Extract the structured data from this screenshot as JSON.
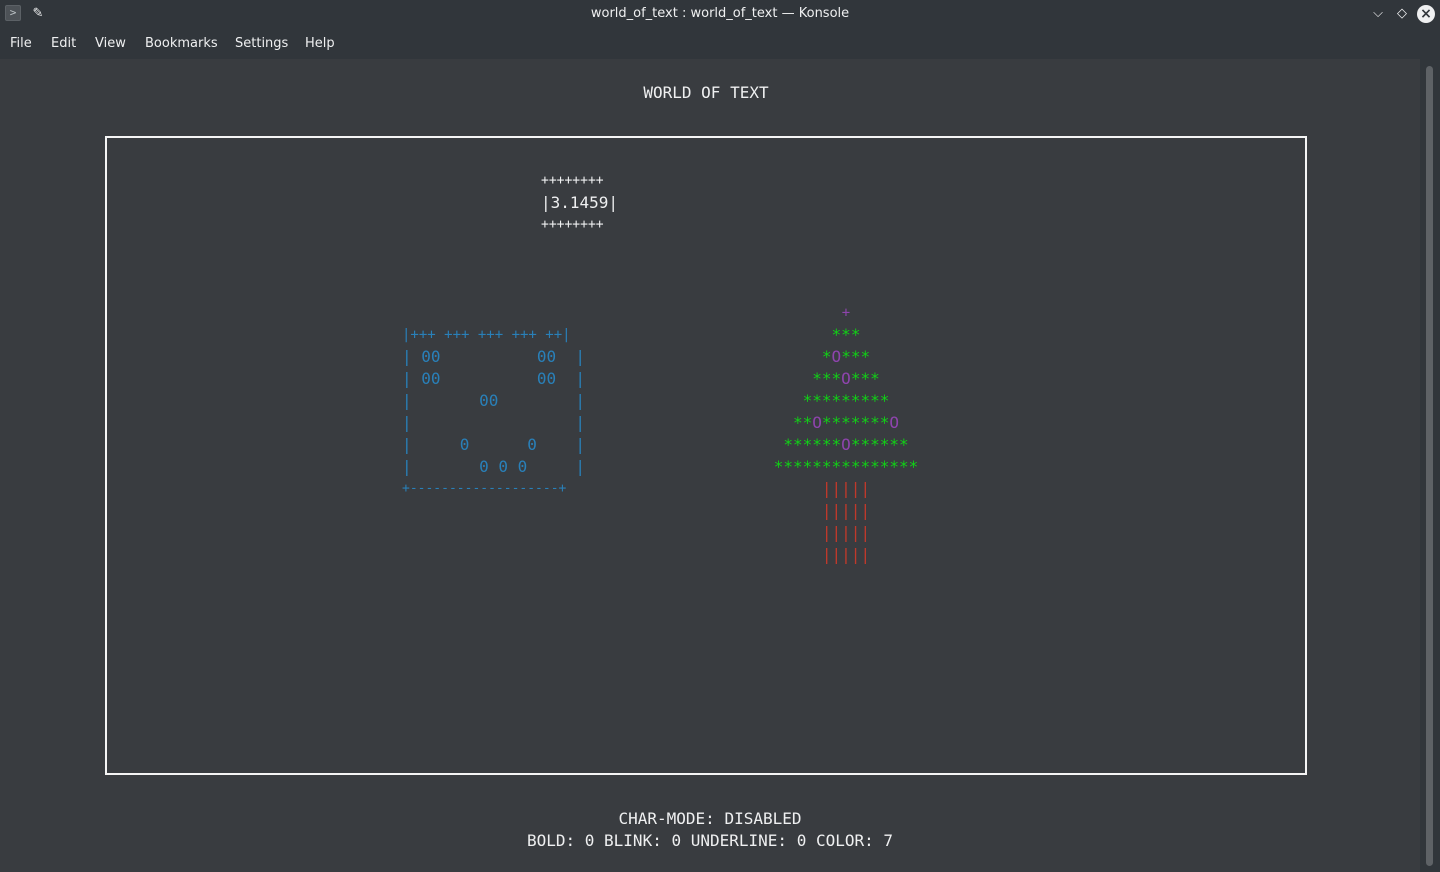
{
  "window": {
    "title": "world_of_text : world_of_text — Konsole",
    "icons": [
      "terminal-icon",
      "pin-icon",
      "minimize-icon",
      "maximize-icon",
      "close-icon"
    ]
  },
  "menubar": {
    "items": [
      "File",
      "Edit",
      "View",
      "Bookmarks",
      "Settings",
      "Help"
    ]
  },
  "terminal": {
    "heading": "WORLD OF TEXT",
    "pi_box": {
      "top": "++++++++",
      "value": "|3.1459|",
      "bottom": "++++++++"
    },
    "house": {
      "lines": [
        "|+++ +++ +++ +++ ++|",
        "| 00          00  |",
        "| 00          00  |",
        "|       00        |",
        "|                 |",
        "|     0      0    |",
        "|       0 0 0     |",
        "+-------------------+"
      ]
    },
    "tree": {
      "top": "+",
      "rows": [
        [
          "***"
        ],
        [
          "*",
          "O",
          "***"
        ],
        [
          "***",
          "O",
          "***"
        ],
        [
          "*********"
        ],
        [
          "**",
          "O",
          "*******",
          "O"
        ],
        [
          "******",
          "O",
          "******"
        ],
        [
          "***************"
        ]
      ],
      "trunk": [
        "|||||",
        "|||||",
        "|||||",
        "|||||"
      ]
    },
    "status": {
      "mode": "CHAR-MODE: DISABLED",
      "attrs": "BOLD: 0 BLINK: 0 UNDERLINE: 0 COLOR: 7"
    },
    "colors": {
      "background": "#393c40",
      "house": "#2980b9",
      "tree_green": "#11d116",
      "ornament_magenta": "#8e44ad",
      "trunk_red": "#c0392b",
      "frame": "#f5f5f5"
    }
  }
}
